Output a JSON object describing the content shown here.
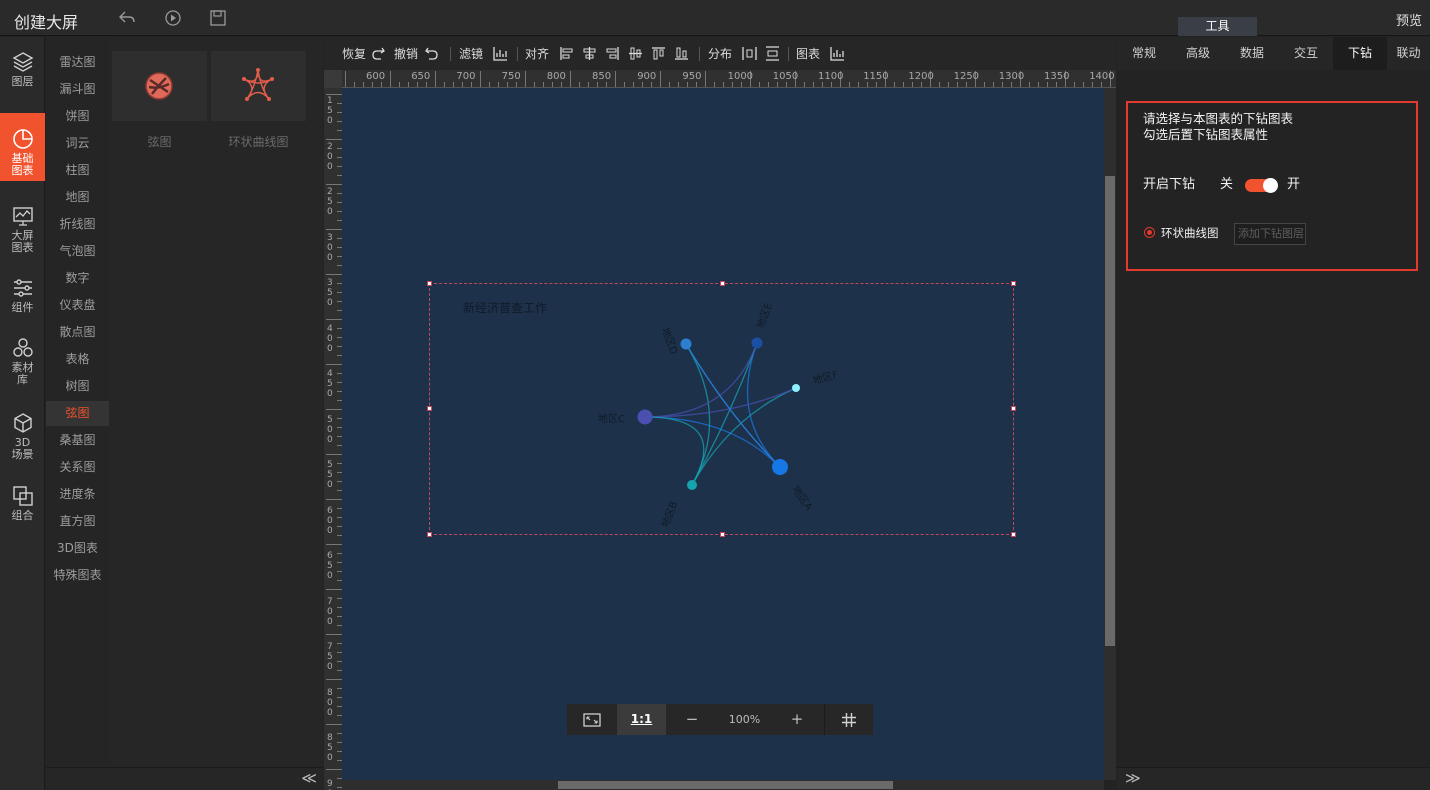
{
  "header": {
    "title": "创建大屏",
    "tools_tab": "工具",
    "preview": "预览"
  },
  "leftnav": [
    {
      "label": "图层",
      "icon": "layers-icon"
    },
    {
      "label": "基础图表",
      "icon": "pie-chart-icon",
      "active": true
    },
    {
      "label": "大屏图表",
      "icon": "screen-chart-icon"
    },
    {
      "label": "组件",
      "icon": "sliders-icon"
    },
    {
      "label": "素材库",
      "icon": "hexagons-icon"
    },
    {
      "label": "3D场景",
      "icon": "cube-icon"
    },
    {
      "label": "组合",
      "icon": "combine-icon"
    }
  ],
  "categories": [
    "雷达图",
    "漏斗图",
    "饼图",
    "词云",
    "柱图",
    "地图",
    "折线图",
    "气泡图",
    "数字",
    "仪表盘",
    "散点图",
    "表格",
    "树图",
    "弦图",
    "桑基图",
    "关系图",
    "进度条",
    "直方图",
    "3D图表",
    "特殊图表"
  ],
  "active_category": "弦图",
  "thumbs": [
    {
      "label": "弦图",
      "icon": "chord-chart-icon"
    },
    {
      "label": "环状曲线图",
      "icon": "ring-curve-chart-icon"
    }
  ],
  "toolbar": {
    "redo": "恢复",
    "undo": "撤销",
    "filter": "滤镜",
    "align": "对齐",
    "distribute": "分布",
    "chart": "图表"
  },
  "ruler": {
    "top": [
      "600",
      "650",
      "700",
      "750",
      "800",
      "850",
      "900",
      "950",
      "1000",
      "1050",
      "1100",
      "1150",
      "1200",
      "1250",
      "1300",
      "1350",
      "1400"
    ],
    "left": [
      "150",
      "200",
      "250",
      "300",
      "350",
      "400",
      "450",
      "500",
      "550",
      "600",
      "650",
      "700",
      "750",
      "800",
      "850",
      "900"
    ]
  },
  "chart": {
    "title": "新经济普查工作",
    "nodes": [
      {
        "name": "地区A",
        "color": "#1877e6"
      },
      {
        "name": "地区B",
        "color": "#17a2b0"
      },
      {
        "name": "地区C",
        "color": "#4a4fb0"
      },
      {
        "name": "地区D",
        "color": "#2e7fd0"
      },
      {
        "name": "地区E",
        "color": "#1b4fa3"
      },
      {
        "name": "地区F",
        "color": "#8ef0ff"
      }
    ]
  },
  "zoom": {
    "fit_icon": "fit-screen-icon",
    "one_to_one": "1:1",
    "minus": "−",
    "value": "100%",
    "plus": "+",
    "grid_icon": "grid-icon"
  },
  "right": {
    "tabs": [
      "常规",
      "高级",
      "数据",
      "交互",
      "下钻",
      "联动"
    ],
    "active_tab": "下钻",
    "hint1": "请选择与本图表的下钻图表",
    "hint2": "勾选后置下钻图表属性",
    "drill_label": "开启下钻",
    "off": "关",
    "on": "开",
    "option": "环状曲线图",
    "add_placeholder": "添加下钻图层"
  },
  "footer": {
    "collapse_left": "≪",
    "collapse_right": "≫"
  }
}
